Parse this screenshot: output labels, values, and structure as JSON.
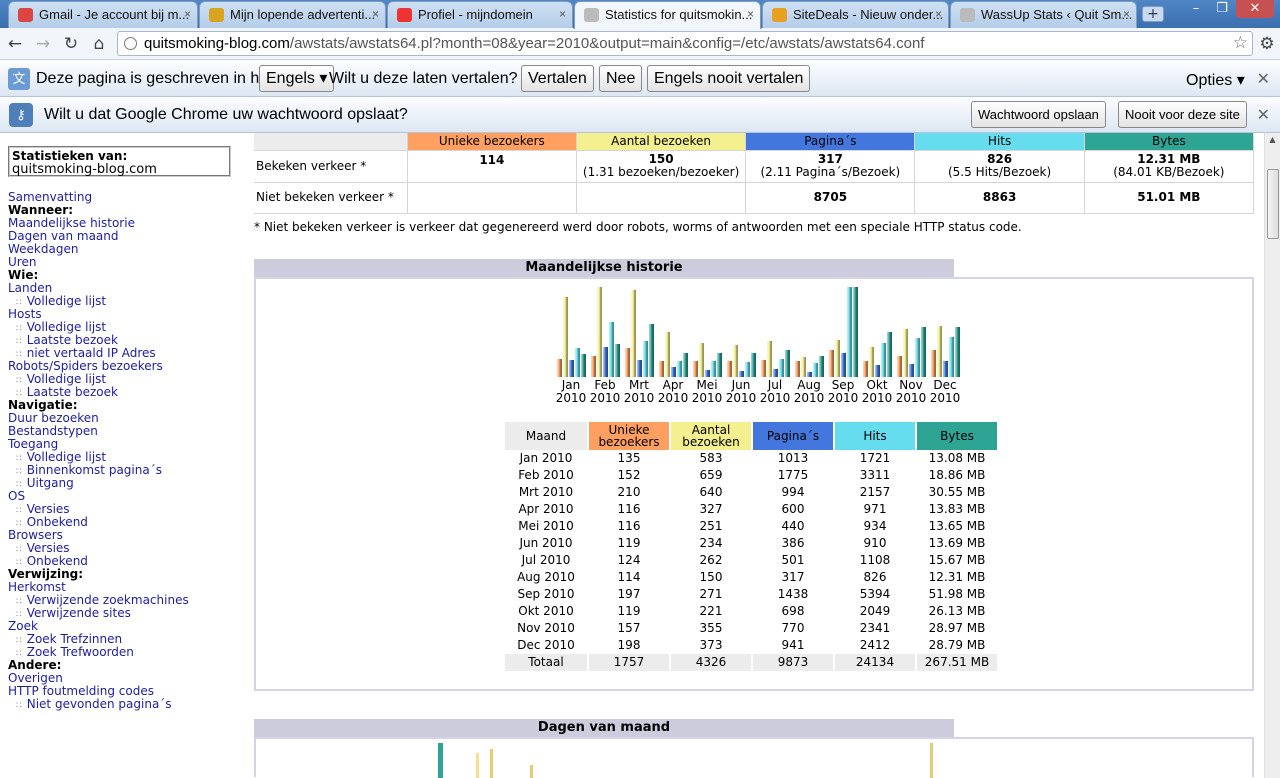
{
  "browser": {
    "tabs": [
      {
        "title": "Gmail - Je account bij m...",
        "fav_color": "#d44"
      },
      {
        "title": "Mijn lopende advertenti...",
        "fav_color": "#d9a520"
      },
      {
        "title": "Profiel - mijndomein",
        "fav_color": "#e33"
      },
      {
        "title": "Statistics for quitsmokin...",
        "fav_color": "#bbb"
      },
      {
        "title": "SiteDeals - Nieuw onder...",
        "fav_color": "#e8a020"
      },
      {
        "title": "WassUp Stats ‹ Quit Sm...",
        "fav_color": "#bbb"
      }
    ],
    "tab_close_glyph": "×",
    "new_tab_glyph": "+",
    "url_host": "quitsmoking-blog.com",
    "url_path": "/awstats/awstats64.pl?month=08&year=2010&output=main&config=/etc/awstats/awstats64.conf",
    "translate_bar": {
      "message": "Deze pagina is geschreven in het",
      "language": "Engels",
      "question": "Wilt u deze laten vertalen?",
      "translate": "Vertalen",
      "no": "Nee",
      "never": "Engels nooit vertalen",
      "options": "Opties"
    },
    "password_bar": {
      "message": "Wilt u dat Google Chrome uw wachtwoord opslaat?",
      "save": "Wachtwoord opslaan",
      "never": "Nooit voor deze site"
    }
  },
  "sidebar": {
    "stats_title": "Statistieken van:",
    "stats_site": "quitsmoking-blog.com",
    "items": [
      {
        "kind": "lnk",
        "text": "Samenvatting"
      },
      {
        "kind": "hdr",
        "text": "Wanneer:"
      },
      {
        "kind": "lnk",
        "text": "Maandelijkse historie"
      },
      {
        "kind": "lnk",
        "text": "Dagen van maand"
      },
      {
        "kind": "lnk",
        "text": "Weekdagen"
      },
      {
        "kind": "lnk",
        "text": "Uren"
      },
      {
        "kind": "hdr",
        "text": "Wie:"
      },
      {
        "kind": "lnk",
        "text": "Landen"
      },
      {
        "kind": "sub",
        "text": "Volledige lijst"
      },
      {
        "kind": "lnk",
        "text": "Hosts"
      },
      {
        "kind": "sub",
        "text": "Volledige lijst"
      },
      {
        "kind": "sub",
        "text": "Laatste bezoek"
      },
      {
        "kind": "sub",
        "text": "niet vertaald IP Adres"
      },
      {
        "kind": "lnk",
        "text": "Robots/Spiders bezoekers"
      },
      {
        "kind": "sub",
        "text": "Volledige lijst"
      },
      {
        "kind": "sub",
        "text": "Laatste bezoek"
      },
      {
        "kind": "hdr",
        "text": "Navigatie:"
      },
      {
        "kind": "lnk",
        "text": "Duur bezoeken"
      },
      {
        "kind": "lnk",
        "text": "Bestandstypen"
      },
      {
        "kind": "lnk",
        "text": "Toegang"
      },
      {
        "kind": "sub",
        "text": "Volledige lijst"
      },
      {
        "kind": "sub",
        "text": "Binnenkomst pagina´s"
      },
      {
        "kind": "sub",
        "text": "Uitgang"
      },
      {
        "kind": "lnk",
        "text": "OS"
      },
      {
        "kind": "sub",
        "text": "Versies"
      },
      {
        "kind": "sub",
        "text": "Onbekend"
      },
      {
        "kind": "lnk",
        "text": "Browsers"
      },
      {
        "kind": "sub",
        "text": "Versies"
      },
      {
        "kind": "sub",
        "text": "Onbekend"
      },
      {
        "kind": "hdr",
        "text": "Verwijzing:"
      },
      {
        "kind": "lnk",
        "text": "Herkomst"
      },
      {
        "kind": "sub",
        "text": "Verwijzende zoekmachines"
      },
      {
        "kind": "sub",
        "text": "Verwijzende sites"
      },
      {
        "kind": "lnk",
        "text": "Zoek"
      },
      {
        "kind": "sub",
        "text": "Zoek Trefzinnen"
      },
      {
        "kind": "sub",
        "text": "Zoek Trefwoorden"
      },
      {
        "kind": "hdr",
        "text": "Andere:"
      },
      {
        "kind": "lnk",
        "text": "Overigen"
      },
      {
        "kind": "lnk",
        "text": "HTTP foutmelding codes"
      },
      {
        "kind": "sub",
        "text": "Niet gevonden pagina´s"
      }
    ]
  },
  "summary": {
    "headers": [
      "Unieke bezoekers",
      "Aantal bezoeken",
      "Pagina´s",
      "Hits",
      "Bytes"
    ],
    "seen_label": "Bekeken verkeer *",
    "seen": {
      "unique": "114",
      "visits": "150",
      "visits_sub": "(1.31 bezoeken/bezoeker)",
      "pages": "317",
      "pages_sub": "(2.11 Pagina´s/Bezoek)",
      "hits": "826",
      "hits_sub": "(5.5 Hits/Bezoek)",
      "bytes": "12.31 MB",
      "bytes_sub": "(84.01 KB/Bezoek)"
    },
    "notseen_label": "Niet bekeken verkeer *",
    "notseen": {
      "pages": "8705",
      "hits": "8863",
      "bytes": "51.01 MB"
    },
    "note": "* Niet bekeken verkeer is verkeer dat gegenereerd werd door robots, worms of antwoorden met een speciale HTTP status code."
  },
  "monthly": {
    "title": "Maandelijkse historie",
    "table_headers": [
      "Maand",
      "Unieke bezoekers",
      "Aantal bezoeken",
      "Pagina´s",
      "Hits",
      "Bytes"
    ],
    "rows": [
      [
        "Jan 2010",
        "135",
        "583",
        "1013",
        "1721",
        "13.08 MB"
      ],
      [
        "Feb 2010",
        "152",
        "659",
        "1775",
        "3311",
        "18.86 MB"
      ],
      [
        "Mrt 2010",
        "210",
        "640",
        "994",
        "2157",
        "30.55 MB"
      ],
      [
        "Apr 2010",
        "116",
        "327",
        "600",
        "971",
        "13.83 MB"
      ],
      [
        "Mei 2010",
        "116",
        "251",
        "440",
        "934",
        "13.65 MB"
      ],
      [
        "Jun 2010",
        "119",
        "234",
        "386",
        "910",
        "13.69 MB"
      ],
      [
        "Jul 2010",
        "124",
        "262",
        "501",
        "1108",
        "15.67 MB"
      ],
      [
        "Aug 2010",
        "114",
        "150",
        "317",
        "826",
        "12.31 MB"
      ],
      [
        "Sep 2010",
        "197",
        "271",
        "1438",
        "5394",
        "51.98 MB"
      ],
      [
        "Okt 2010",
        "119",
        "221",
        "698",
        "2049",
        "26.13 MB"
      ],
      [
        "Nov 2010",
        "157",
        "355",
        "770",
        "2341",
        "28.97 MB"
      ],
      [
        "Dec 2010",
        "198",
        "373",
        "941",
        "2412",
        "28.79 MB"
      ]
    ],
    "total": [
      "Totaal",
      "1757",
      "4326",
      "9873",
      "24134",
      "267.51 MB"
    ]
  },
  "days": {
    "title": "Dagen van maand"
  },
  "colors": {
    "unique": "#ffa060",
    "visits": "#f4f090",
    "pages": "#4477dd",
    "hits": "#66ddee",
    "bytes": "#2ea495",
    "section_title": "#ccccdd"
  },
  "chart_data": {
    "type": "bar",
    "categories": [
      "Jan 2010",
      "Feb 2010",
      "Mrt 2010",
      "Apr 2010",
      "Mei 2010",
      "Jun 2010",
      "Jul 2010",
      "Aug 2010",
      "Sep 2010",
      "Okt 2010",
      "Nov 2010",
      "Dec 2010"
    ],
    "category_lines": [
      [
        "Jan",
        "2010"
      ],
      [
        "Feb",
        "2010"
      ],
      [
        "Mrt",
        "2010"
      ],
      [
        "Apr",
        "2010"
      ],
      [
        "Mei",
        "2010"
      ],
      [
        "Jun",
        "2010"
      ],
      [
        "Jul",
        "2010"
      ],
      [
        "Aug",
        "2010"
      ],
      [
        "Sep",
        "2010"
      ],
      [
        "Okt",
        "2010"
      ],
      [
        "Nov",
        "2010"
      ],
      [
        "Dec",
        "2010"
      ]
    ],
    "series": [
      {
        "key": "unique",
        "values": [
          135,
          152,
          210,
          116,
          116,
          119,
          124,
          114,
          197,
          119,
          157,
          198
        ]
      },
      {
        "key": "visits",
        "values": [
          583,
          659,
          640,
          327,
          251,
          234,
          262,
          150,
          271,
          221,
          355,
          373
        ]
      },
      {
        "key": "pages",
        "values": [
          1013,
          1775,
          994,
          600,
          440,
          386,
          501,
          317,
          1438,
          698,
          770,
          941
        ]
      },
      {
        "key": "hits",
        "values": [
          1721,
          3311,
          2157,
          971,
          934,
          910,
          1108,
          826,
          5394,
          2049,
          2341,
          2412
        ]
      },
      {
        "key": "bytes",
        "values": [
          13.08,
          18.86,
          30.55,
          13.83,
          13.65,
          13.69,
          15.67,
          12.31,
          51.98,
          26.13,
          28.97,
          28.79
        ]
      }
    ]
  }
}
